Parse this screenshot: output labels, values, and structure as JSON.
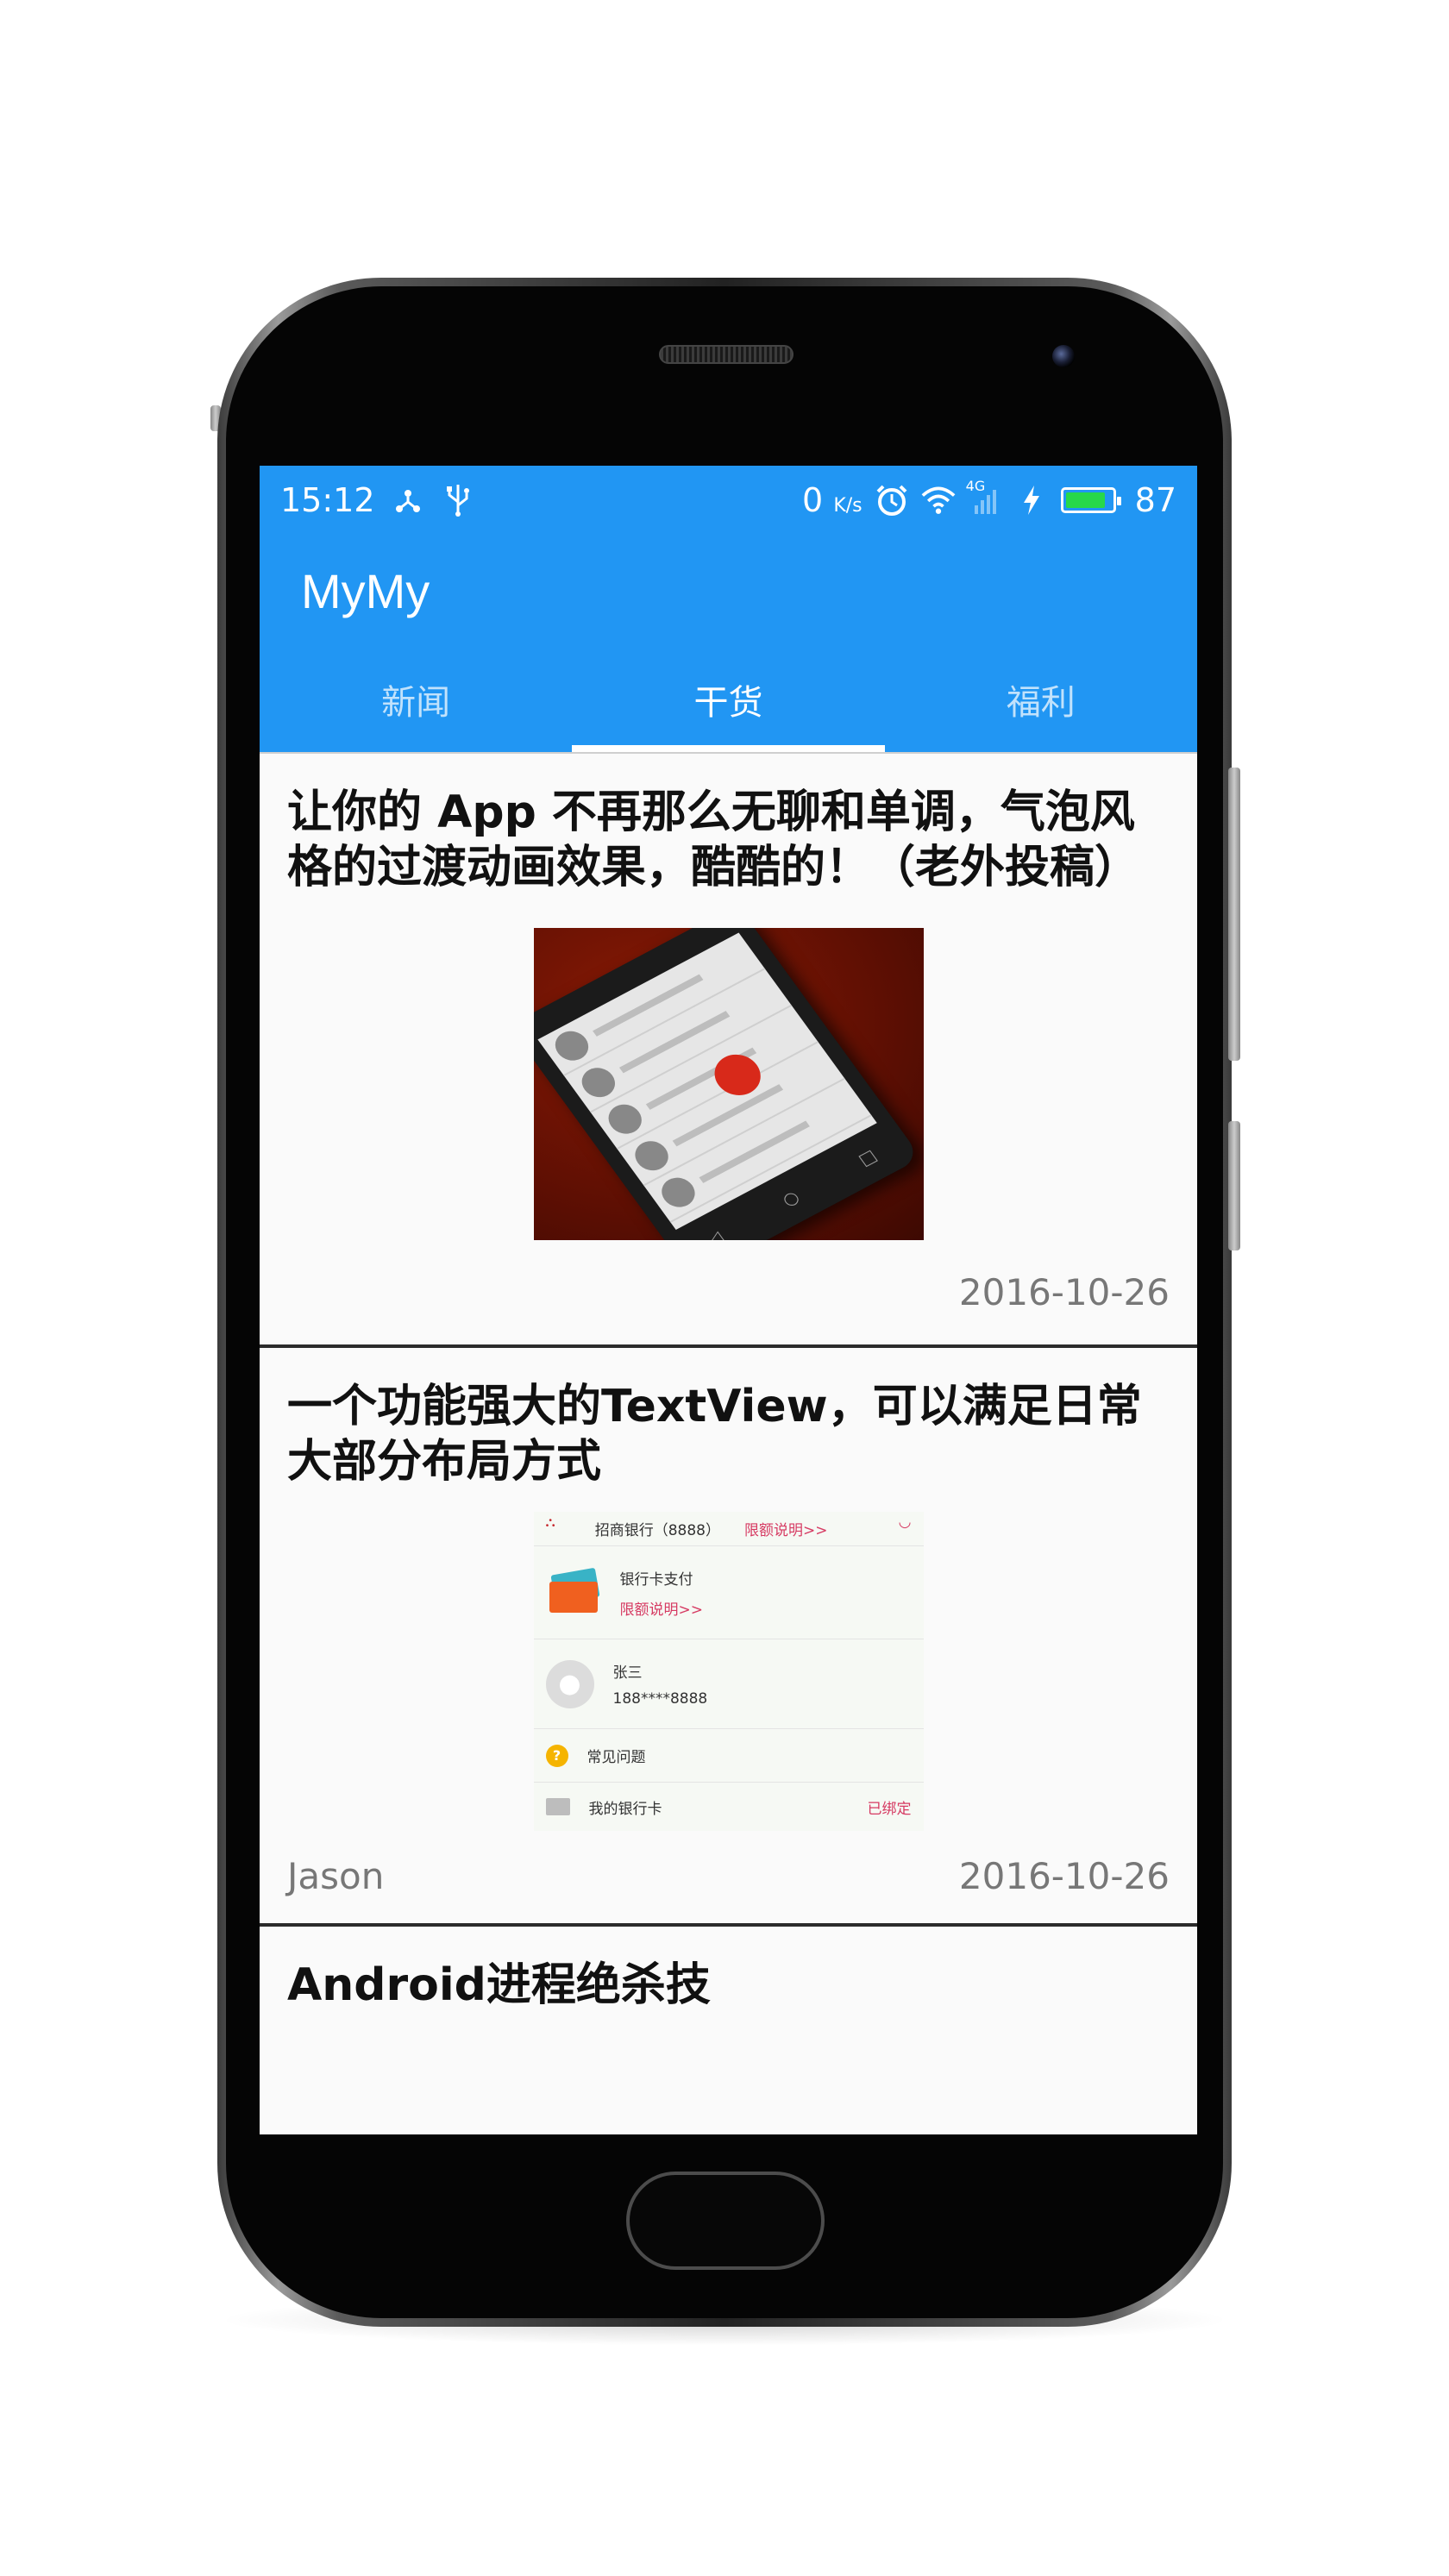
{
  "status_bar": {
    "time": "15:12",
    "net_speed": "0",
    "net_unit": "K/s",
    "signal_label": "4G",
    "battery_level": "87",
    "battery_fraction": 0.87,
    "battery_color": "#27d84a",
    "icons": [
      "share-hub-icon",
      "usb-icon",
      "alarm-icon",
      "wifi-icon",
      "signal-icon",
      "charging-icon",
      "battery-icon"
    ]
  },
  "app_bar": {
    "title": "MyMy",
    "color": "#2196f3"
  },
  "tabs": [
    {
      "label": "新闻",
      "active": false
    },
    {
      "label": "干货",
      "active": true
    },
    {
      "label": "福利",
      "active": false
    }
  ],
  "feed": [
    {
      "title": "让你的 App 不再那么无聊和单调，气泡风格的过渡动画效果，酷酷的！（老外投稿）",
      "author": "",
      "date": "2016-10-26"
    },
    {
      "title": "一个功能强大的TextView，可以满足日常大部分布局方式",
      "author": "Jason",
      "date": "2016-10-26",
      "image_content": {
        "bank_row": "招商银行（8888）",
        "bank_limit": "限额说明>>",
        "card_pay": "银行卡支付",
        "card_limit": "限额说明>>",
        "user_name": "张三",
        "user_phone": "188****8888",
        "faq": "常见问题",
        "my_cards": "我的银行卡",
        "bound": "已绑定"
      }
    },
    {
      "title": "Android进程绝杀技"
    }
  ]
}
